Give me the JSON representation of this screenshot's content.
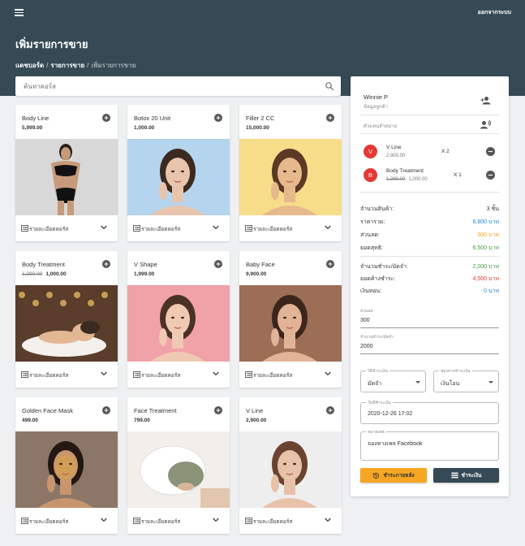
{
  "topbar": {
    "logout_label": "ออกจากระบบ"
  },
  "page_title": "เพิ่มรายการขาย",
  "breadcrumb": {
    "dashboard": "แดชบอร์ด",
    "sales": "รายการขาย",
    "current": "เพิ่มรายการขาย",
    "separator": "/"
  },
  "search": {
    "placeholder": "ค้นหาคอร์ส"
  },
  "detail_label": "รายละเอียดคอร์ส",
  "products": [
    {
      "name": "Body Line",
      "price": "5,999.00",
      "old_price": ""
    },
    {
      "name": "Botox 20 Unit",
      "price": "1,000.00",
      "old_price": ""
    },
    {
      "name": "Filler 2 CC",
      "price": "15,000.00",
      "old_price": ""
    },
    {
      "name": "Body Treatment",
      "price": "1,000.00",
      "old_price": "1,290.00"
    },
    {
      "name": "V Shape",
      "price": "1,999.00",
      "old_price": ""
    },
    {
      "name": "Baby Face",
      "price": "9,900.00",
      "old_price": ""
    },
    {
      "name": "Golden Face Mask",
      "price": "499.00",
      "old_price": ""
    },
    {
      "name": "Face Treatment",
      "price": "799.00",
      "old_price": ""
    },
    {
      "name": "V Line",
      "price": "2,900.00",
      "old_price": ""
    }
  ],
  "panel": {
    "customer_name": "Winnie P",
    "customer_sub": "ข้อมูลลูกค้า",
    "rep_label": "ตัวแทนจำหน่าย",
    "cart": [
      {
        "initial": "V",
        "name": "V Line",
        "price": "2,900.00",
        "old_price": "",
        "qty": "X 2"
      },
      {
        "initial": "B",
        "name": "Body Treatment",
        "price": "1,000.00",
        "old_price": "1,290.00",
        "qty": "X 1"
      }
    ],
    "summary": [
      {
        "label": "จำนวนสินค้า:",
        "value": "3 ชิ้น",
        "color": "#333333"
      },
      {
        "label": "ราคารวม:",
        "value": "6,800 บาท",
        "color": "#1e88e5"
      },
      {
        "label": "ส่วนลด:",
        "value": "300 บาท",
        "color": "#f5a623"
      },
      {
        "label": "ยอดสุทธิ:",
        "value": "6,500 บาท",
        "color": "#43a047"
      }
    ],
    "payments": [
      {
        "label": "จำนวนชำระ/มัดจำ:",
        "value": "2,000 บาท",
        "color": "#43a047"
      },
      {
        "label": "ยอดค้างชำระ:",
        "value": "4,500 บาท",
        "color": "#e53935"
      },
      {
        "label": "เงินทอน:",
        "value": "0 บาท",
        "color": "#1e88e5"
      }
    ],
    "discount": {
      "label": "ส่วนลด",
      "value": "300"
    },
    "paid": {
      "label": "จำนวนชำระ/มัดจำ",
      "value": "2000"
    },
    "pay_method": {
      "label": "วิธีชำระเงิน",
      "value": "มัดจำ"
    },
    "pay_channel": {
      "label": "ช่องทางชำระเงิน",
      "value": "เงินโอน"
    },
    "pay_date": {
      "label": "วันที่ชำระเงิน",
      "value": "2020-12-26 17:02"
    },
    "note": {
      "label": "หมายเหตุ",
      "value": "จองทางเพจ Facebook"
    },
    "later_button": "ชำระภายหลัง",
    "pay_button": "ชำระเงิน"
  },
  "colors": {
    "header": "#364a55",
    "accent_orange": "#f5a623",
    "danger": "#e53935",
    "dark_button": "#364a55"
  },
  "icons": [
    "menu-icon",
    "search-icon",
    "add-circle-icon",
    "detail-list-icon",
    "chevron-down-icon",
    "add-person-icon",
    "representative-icon",
    "remove-circle-icon",
    "history-icon",
    "payment-icon"
  ]
}
